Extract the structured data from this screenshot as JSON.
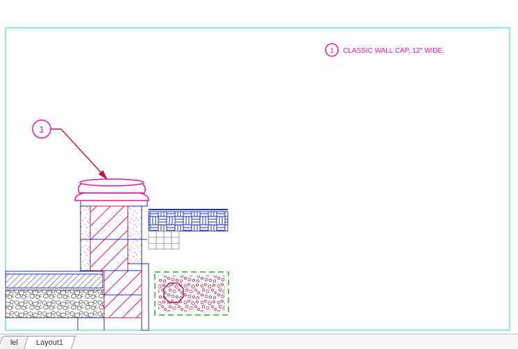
{
  "tabs": {
    "model_label": "lel",
    "layout_label": "Layout1"
  },
  "callout": {
    "number": "1"
  },
  "keynote": {
    "number": "1",
    "text": "CLASSIC WALL CAP, 12\" WIDE."
  }
}
